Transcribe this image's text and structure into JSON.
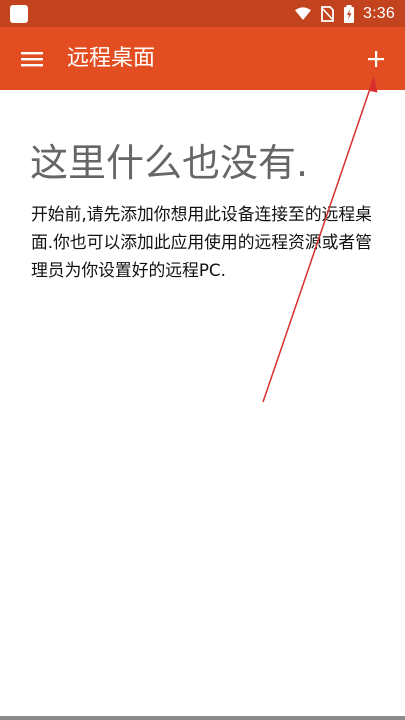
{
  "status_bar": {
    "time": "3:36",
    "icons": [
      "app-square-icon",
      "wifi-icon",
      "no-sim-icon",
      "battery-charging-icon"
    ]
  },
  "app_bar": {
    "title": "远程桌面",
    "menu_icon": "hamburger-menu-icon",
    "add_icon": "plus-icon"
  },
  "empty_state": {
    "title": "这里什么也没有.",
    "description": "开始前,请先添加你想用此设备连接至的远程桌面.你也可以添加此应用使用的远程资源或者管理员为你设置好的远程PC."
  },
  "colors": {
    "status_bar": "#c2431e",
    "app_bar": "#e24e22",
    "annotation": "#d92f2f",
    "background": "#ffffff"
  }
}
